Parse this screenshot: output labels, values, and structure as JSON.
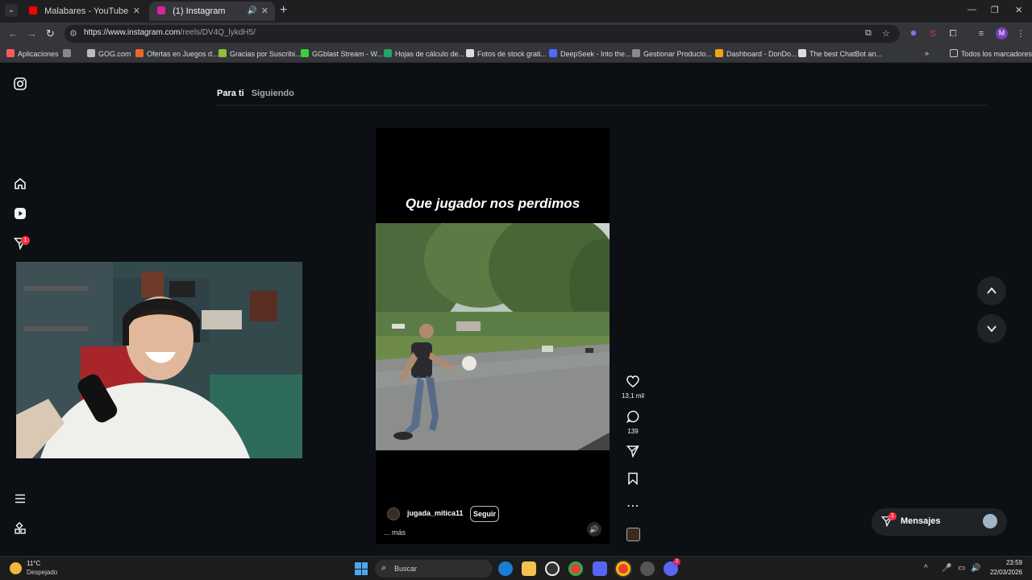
{
  "browser": {
    "tabs": [
      {
        "title": "Malabares - YouTube",
        "favicon_color": "#ff0000"
      },
      {
        "title": "(1) Instagram",
        "favicon_color": "#d6249f"
      }
    ],
    "url_host": "https://www.instagram.com",
    "url_path": "/reels/DV4Q_lykdH5/",
    "profile_initial": "M",
    "bookmarks": [
      {
        "label": "Aplicaciones",
        "icon_color": "#ff5a5a"
      },
      {
        "label": "GOG.com",
        "icon_color": "#bbbbbb"
      },
      {
        "label": "Ofertas en Juegos d...",
        "icon_color": "#e86a2a"
      },
      {
        "label": "Gracias por Suscribi...",
        "icon_color": "#8fbf3f"
      },
      {
        "label": "GGblast Stream - W...",
        "icon_color": "#3ccf3c"
      },
      {
        "label": "Hojas de cálculo de...",
        "icon_color": "#22a565"
      },
      {
        "label": "Fotos de stock grati...",
        "icon_color": "#dddddd"
      },
      {
        "label": "DeepSeek - Into the...",
        "icon_color": "#4d6bfe"
      },
      {
        "label": "Gestionar Producto...",
        "icon_color": "#8a8a8a"
      },
      {
        "label": "Dashboard - DonDo...",
        "icon_color": "#f0a31c"
      },
      {
        "label": "The best ChatBot an...",
        "icon_color": "#dddddd"
      }
    ],
    "all_bookmarks": "Todos los marcadores"
  },
  "instagram": {
    "feed_tabs": {
      "active": "Para ti",
      "inactive": "Siguiendo"
    },
    "notification_count": "1",
    "reel": {
      "overlay_text": "Que jugador nos perdimos",
      "username": "jugada_mitica11",
      "follow_label": "Seguir",
      "more_label": "... más",
      "likes": "13,1 mil",
      "comments": "139"
    },
    "messages": {
      "label": "Mensajes",
      "badge": "1"
    }
  },
  "taskbar": {
    "temperature": "11°C",
    "weather": "Despejado",
    "search_placeholder": "Buscar",
    "time": "23:59",
    "date": "22/03/2026",
    "discord_badge": "2"
  }
}
